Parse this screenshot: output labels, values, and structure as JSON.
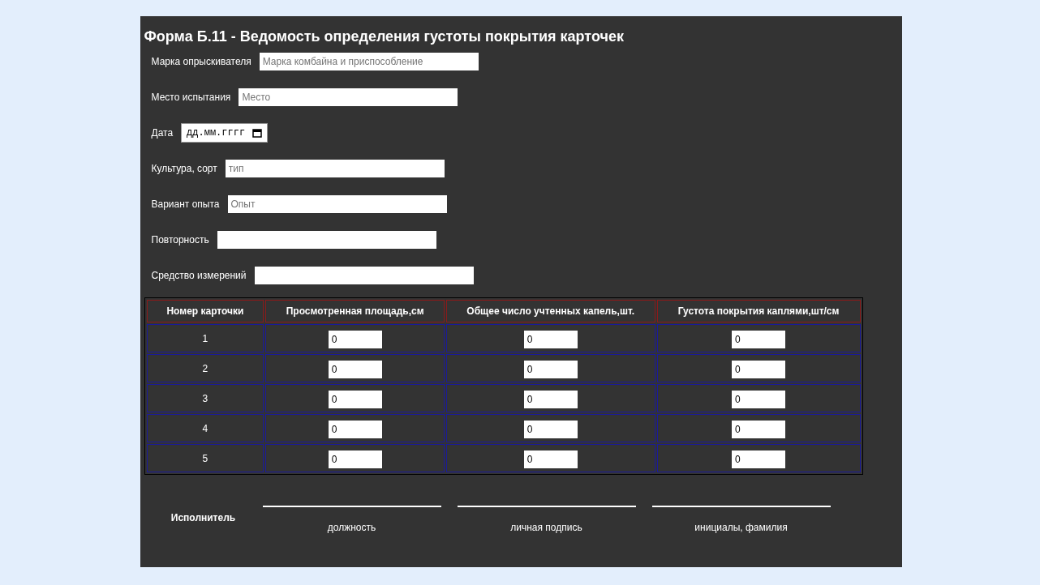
{
  "title": "Форма Б.11 - Ведомость определения густоты покрытия карточек",
  "fields": [
    {
      "label": "Марка опрыскивателя",
      "kind": "text",
      "placeholder": "Марка комбайна и приспособление"
    },
    {
      "label": "Место испытания",
      "kind": "text",
      "placeholder": "Место"
    },
    {
      "label": "Дата",
      "kind": "date",
      "placeholder": "дд.мм.гггг"
    },
    {
      "label": "Культура, сорт",
      "kind": "text",
      "placeholder": "тип"
    },
    {
      "label": "Вариант опыта",
      "kind": "text",
      "placeholder": "Опыт"
    },
    {
      "label": "Повторность",
      "kind": "text"
    },
    {
      "label": "Средство измерений",
      "kind": "text"
    }
  ],
  "table": {
    "columns": [
      "Номер карточки",
      "Просмотренная площадь,см",
      "Общее число учтенных капель,шт.",
      "Густота покрытия каплями,шт/см"
    ],
    "rows": [
      {
        "number": "1",
        "values": [
          "0",
          "0",
          "0"
        ]
      },
      {
        "number": "2",
        "values": [
          "0",
          "0",
          "0"
        ]
      },
      {
        "number": "3",
        "values": [
          "0",
          "0",
          "0"
        ]
      },
      {
        "number": "4",
        "values": [
          "0",
          "0",
          "0"
        ]
      },
      {
        "number": "5",
        "values": [
          "0",
          "0",
          "0"
        ]
      }
    ]
  },
  "signature": {
    "label": "Исполнитель",
    "captions": [
      "должность",
      "личная подпись",
      "инициалы, фамилия"
    ]
  }
}
